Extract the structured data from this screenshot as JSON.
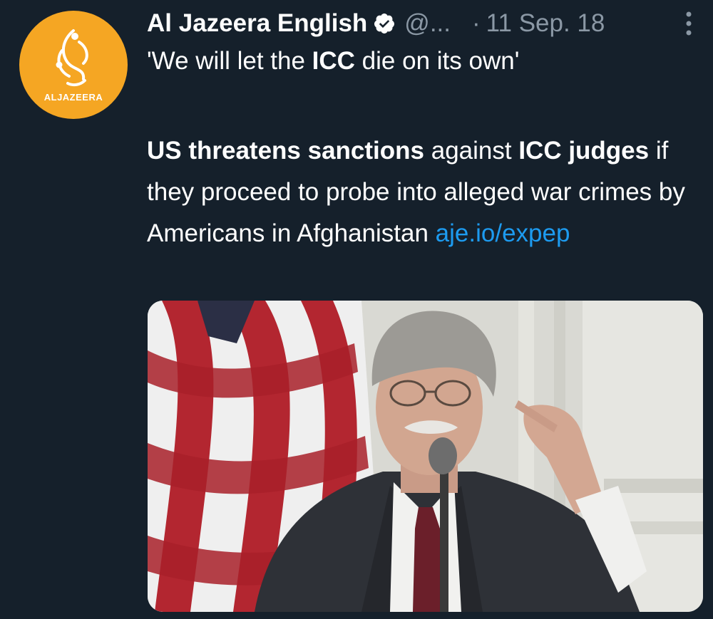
{
  "account": {
    "name": "Al Jazeera English",
    "handle": "@...",
    "separator": "·",
    "date": "11 Sep. 18",
    "avatar_label": "ALJAZEERA",
    "avatar_color": "#f5a623",
    "verified_icon": "verified-badge-icon",
    "more_icon": "more-vertical-icon"
  },
  "tweet": {
    "quote": {
      "pre": "'We will let the ",
      "bold": "ICC",
      "post": " die on its own'"
    },
    "body": {
      "s1_bold": "US threatens sanctions",
      "s2": " against ",
      "s3_bold": "ICC judges",
      "s4": " if they proceed to probe into alleged war crimes by Americans in Afghanistan ",
      "link": "aje.io/expep"
    }
  },
  "colors": {
    "background": "#15202b",
    "link": "#1d9bf0",
    "secondary": "#8b98a5"
  }
}
